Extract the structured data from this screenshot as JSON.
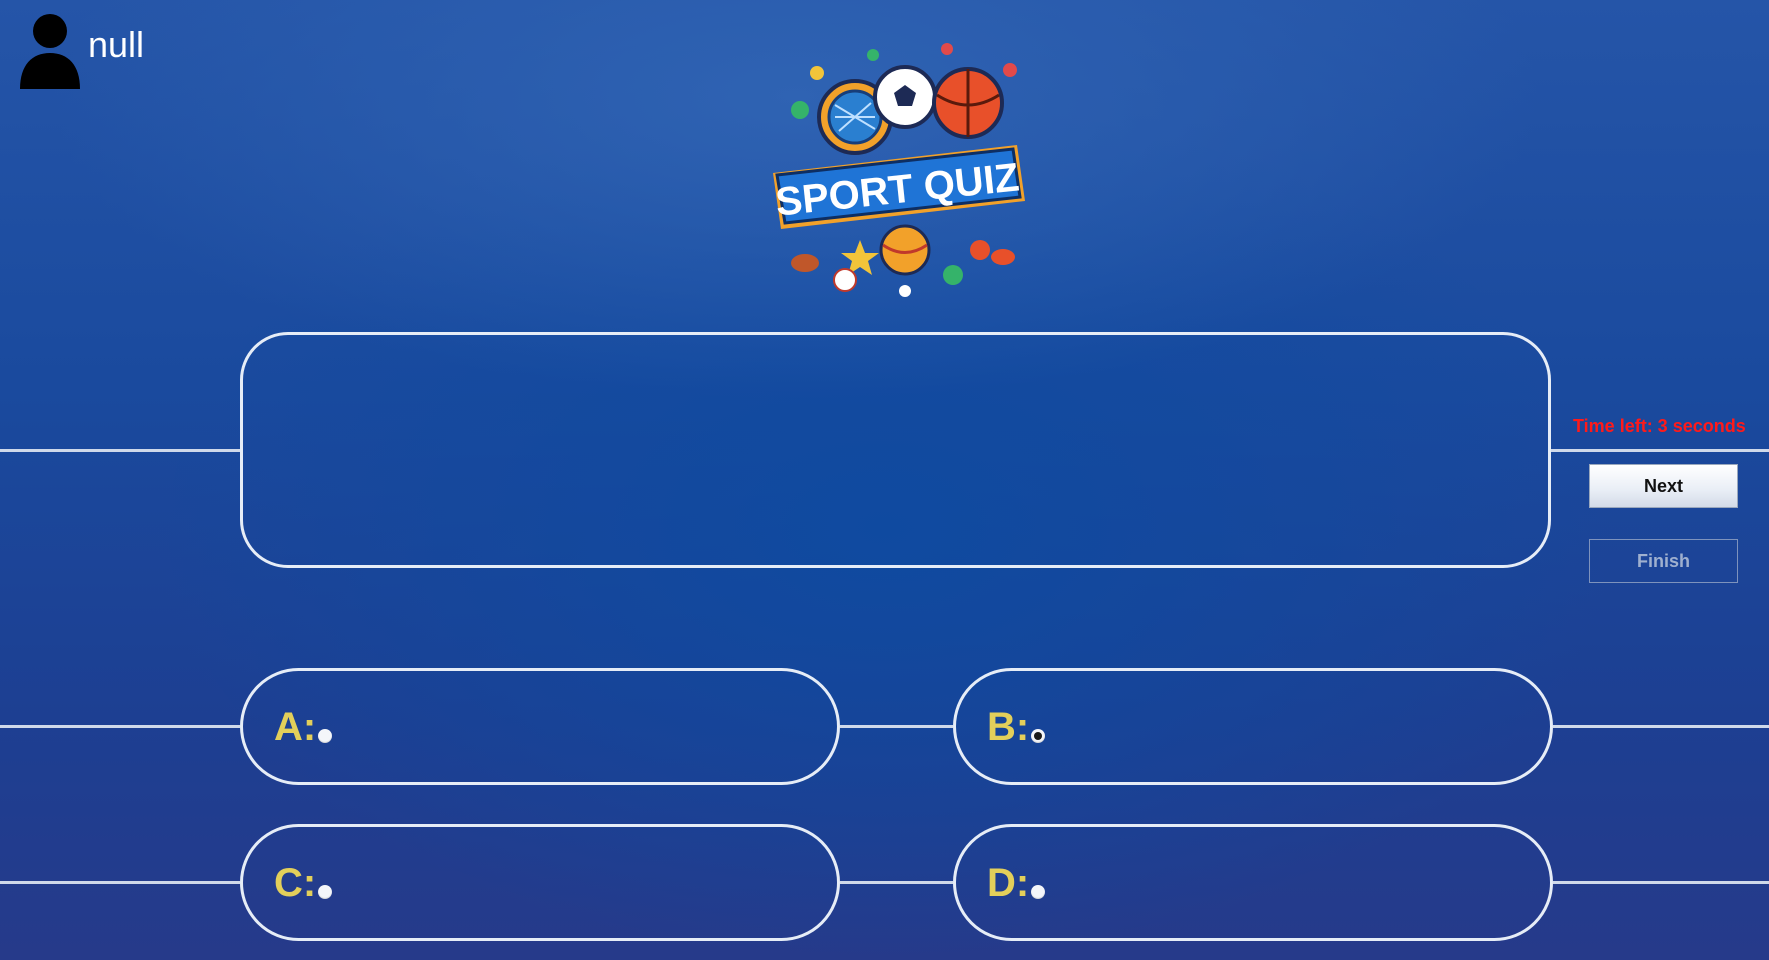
{
  "user": {
    "name": "null",
    "icon": "user-icon"
  },
  "logo": {
    "text": "SPORT QUIZ"
  },
  "question": {
    "text": ""
  },
  "timer": {
    "text": "Time left: 3 seconds",
    "color": "#ff1a1a"
  },
  "buttons": {
    "next": "Next",
    "finish": "Finish"
  },
  "options": [
    {
      "letter": "A:",
      "text": "",
      "selected": false
    },
    {
      "letter": "B:",
      "text": "",
      "selected": true
    },
    {
      "letter": "C:",
      "text": "",
      "selected": false
    },
    {
      "letter": "D:",
      "text": "",
      "selected": false
    }
  ],
  "colors": {
    "background": "#1a4a9e",
    "outline": "#e6edf7",
    "option_letter": "#e3cf5a"
  }
}
